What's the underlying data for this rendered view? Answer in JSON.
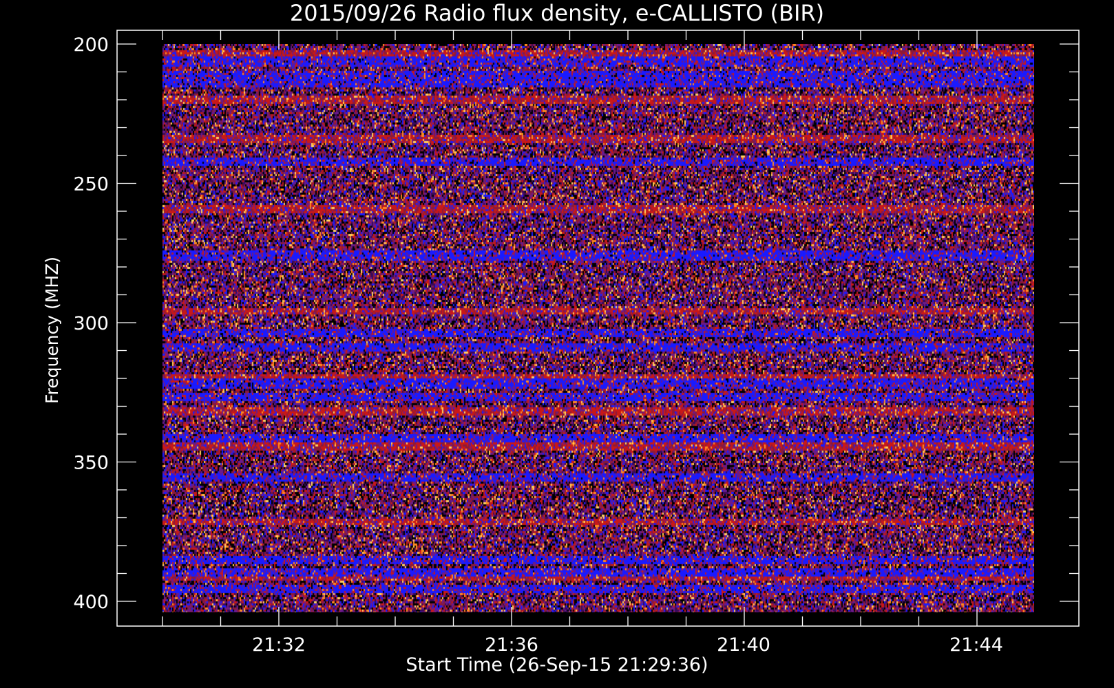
{
  "chart_data": {
    "type": "heatmap",
    "title": "2015/09/26  Radio flux density, e-CALLISTO (BIR)",
    "xlabel": "Start Time (26-Sep-15 21:29:36)",
    "ylabel": "Frequency (MHZ)",
    "x_ticks": [
      "21:32",
      "21:36",
      "21:40",
      "21:44"
    ],
    "y_ticks": [
      "200",
      "250",
      "300",
      "350",
      "400"
    ],
    "x_range": [
      "21:29:36",
      "21:44:54"
    ],
    "ylim": [
      200,
      400
    ],
    "y_inverted": true,
    "grid": false,
    "colormap": [
      "#000000",
      "#3a0a5a",
      "#6a1a8a",
      "#8a1a3a",
      "#c81818",
      "#1a1aff",
      "#ff8a20",
      "#ffd060"
    ],
    "dominant_blue_bands_mhz": [
      206,
      211,
      214,
      242,
      276,
      304,
      309,
      322,
      327,
      342,
      356,
      386,
      390,
      396
    ],
    "dominant_red_bands_mhz": [
      203,
      220,
      234,
      259,
      296,
      320,
      332,
      345,
      372,
      392
    ]
  },
  "colors": {
    "background": "#000000",
    "axis": "#ffffff",
    "text": "#ffffff"
  }
}
